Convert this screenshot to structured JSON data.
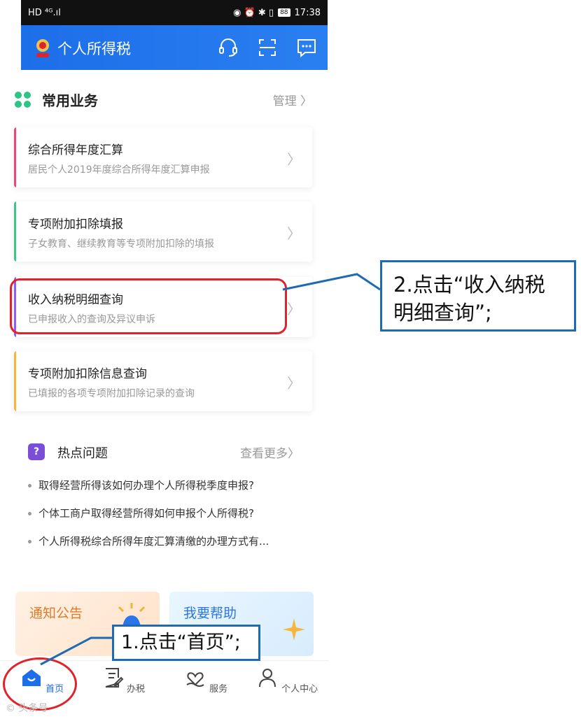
{
  "status_bar": {
    "left": "HD ⁴ᴳ.ıl",
    "battery": "88",
    "time": "17:38"
  },
  "app_bar": {
    "title": "个人所得税"
  },
  "section": {
    "title": "常用业务",
    "manage": "管理"
  },
  "cards": [
    {
      "title": "综合所得年度汇算",
      "subtitle": "居民个人2019年度综合所得年度汇算申报",
      "color": "#e8457a"
    },
    {
      "title": "专项附加扣除填报",
      "subtitle": "子女教育、继续教育等专项附加扣除的填报",
      "color": "#3fc38a"
    },
    {
      "title": "收入纳税明细查询",
      "subtitle": "已申报收入的查询及异议申诉",
      "color": "#8b5cf6"
    },
    {
      "title": "专项附加扣除信息查询",
      "subtitle": "已填报的各项专项附加扣除记录的查询",
      "color": "#f5b63c"
    }
  ],
  "hot": {
    "title": "热点问题",
    "more": "查看更多",
    "items": [
      "取得经营所得该如何办理个人所得税季度申报?",
      "个体工商户取得经营所得如何申报个人所得税?",
      "个人所得税综合所得年度汇算清缴的办理方式有..."
    ]
  },
  "tiles": {
    "notice": "通知公告",
    "help": "我要帮助"
  },
  "tabs": [
    {
      "label": "首页"
    },
    {
      "label": "办税"
    },
    {
      "label": "服务"
    },
    {
      "label": "个人中心"
    }
  ],
  "annotations": {
    "step1": "1.点击“首页”;",
    "step2_line1": "2.点击“收入纳税",
    "step2_line2": "明细查询”;"
  },
  "watermark": "© 头条号"
}
